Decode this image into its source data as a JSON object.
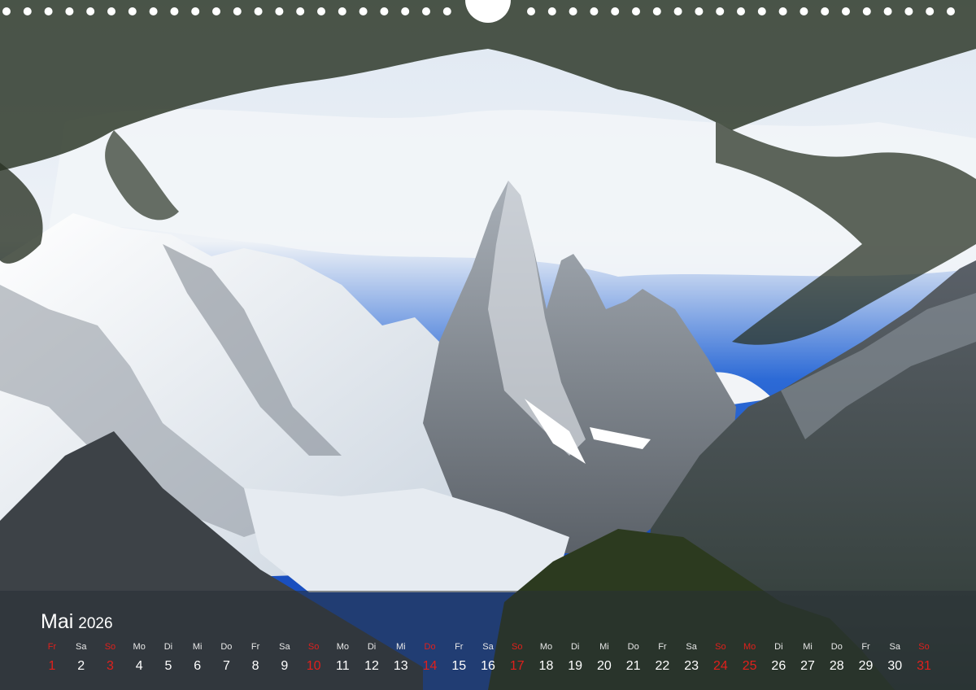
{
  "calendar": {
    "month": "Mai",
    "year": "2026",
    "days": [
      {
        "wd": "Fr",
        "d": "1",
        "red": true
      },
      {
        "wd": "Sa",
        "d": "2",
        "red": false
      },
      {
        "wd": "So",
        "d": "3",
        "red": true
      },
      {
        "wd": "Mo",
        "d": "4",
        "red": false
      },
      {
        "wd": "Di",
        "d": "5",
        "red": false
      },
      {
        "wd": "Mi",
        "d": "6",
        "red": false
      },
      {
        "wd": "Do",
        "d": "7",
        "red": false
      },
      {
        "wd": "Fr",
        "d": "8",
        "red": false
      },
      {
        "wd": "Sa",
        "d": "9",
        "red": false
      },
      {
        "wd": "So",
        "d": "10",
        "red": true
      },
      {
        "wd": "Mo",
        "d": "11",
        "red": false
      },
      {
        "wd": "Di",
        "d": "12",
        "red": false
      },
      {
        "wd": "Mi",
        "d": "13",
        "red": false
      },
      {
        "wd": "Do",
        "d": "14",
        "red": true
      },
      {
        "wd": "Fr",
        "d": "15",
        "red": false
      },
      {
        "wd": "Sa",
        "d": "16",
        "red": false
      },
      {
        "wd": "So",
        "d": "17",
        "red": true
      },
      {
        "wd": "Mo",
        "d": "18",
        "red": false
      },
      {
        "wd": "Di",
        "d": "19",
        "red": false
      },
      {
        "wd": "Mi",
        "d": "20",
        "red": false
      },
      {
        "wd": "Do",
        "d": "21",
        "red": false
      },
      {
        "wd": "Fr",
        "d": "22",
        "red": false
      },
      {
        "wd": "Sa",
        "d": "23",
        "red": false
      },
      {
        "wd": "So",
        "d": "24",
        "red": true
      },
      {
        "wd": "Mo",
        "d": "25",
        "red": true
      },
      {
        "wd": "Di",
        "d": "26",
        "red": false
      },
      {
        "wd": "Mi",
        "d": "27",
        "red": false
      },
      {
        "wd": "Do",
        "d": "28",
        "red": false
      },
      {
        "wd": "Fr",
        "d": "29",
        "red": false
      },
      {
        "wd": "Sa",
        "d": "30",
        "red": false
      },
      {
        "wd": "So",
        "d": "31",
        "red": true
      }
    ]
  },
  "colors": {
    "holiday_red": "#e0201c",
    "sky_blue": "#1f5fd0",
    "band_overlay": "#283034"
  }
}
